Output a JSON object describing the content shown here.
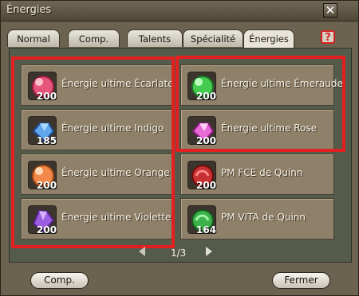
{
  "window": {
    "title": "Énergies",
    "close_symbol": "✕",
    "help_symbol": "?"
  },
  "tabs": [
    {
      "label": "Normal"
    },
    {
      "label": "Comp."
    },
    {
      "label": "Talents"
    },
    {
      "label": "Spécialité"
    },
    {
      "label": "Énergies",
      "active": true
    }
  ],
  "items": [
    {
      "name": "Énergie ultime Écarlate",
      "quantity": "200",
      "icon": "red-gem-icon",
      "color": "#e6557b"
    },
    {
      "name": "Énergie ultime Indigo",
      "quantity": "185",
      "icon": "blue-crystal-icon",
      "color": "#5fa6ea"
    },
    {
      "name": "Énergie ultime Orange",
      "quantity": "200",
      "icon": "orange-gem-icon",
      "color": "#f2894b"
    },
    {
      "name": "Énergie ultime Violette",
      "quantity": "200",
      "icon": "purple-crystal-icon",
      "color": "#9b5ee0"
    },
    {
      "name": "Énergie ultime Émeraude",
      "quantity": "200",
      "icon": "green-gem-icon",
      "color": "#46cb52"
    },
    {
      "name": "Énergie ultime Rose",
      "quantity": "200",
      "icon": "pink-crystal-icon",
      "color": "#e86ad6"
    },
    {
      "name": "PM FCE de Quinn",
      "quantity": "200",
      "icon": "red-orb-icon",
      "color": "#c83131"
    },
    {
      "name": "PM VITA de Quinn",
      "quantity": "164",
      "icon": "green-orb-icon",
      "color": "#3cb14b"
    }
  ],
  "pager": {
    "current": "1/3"
  },
  "buttons": {
    "comp": "Comp.",
    "close": "Fermer"
  }
}
